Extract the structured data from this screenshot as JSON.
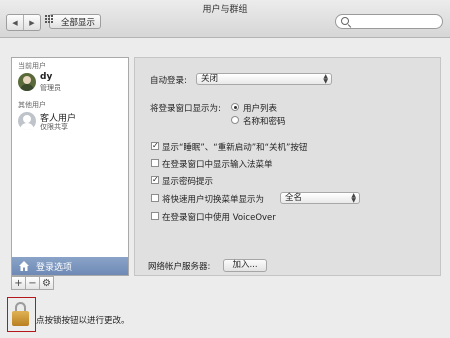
{
  "window": {
    "title": "用户与群组"
  },
  "toolbar": {
    "back_icon": "back-icon",
    "forward_icon": "forward-icon",
    "show_all_label": "全部显示",
    "search_placeholder": ""
  },
  "sidebar": {
    "current_users_label": "当前用户",
    "current_user": {
      "name": "dy",
      "role": "管理员"
    },
    "other_users_label": "其他用户",
    "guest_user": {
      "name": "客人用户",
      "role": "仅限共享"
    },
    "login_options_label": "登录选项",
    "add_label": "+",
    "remove_label": "−",
    "action_label": "⚙"
  },
  "options": {
    "auto_login_label": "自动登录:",
    "auto_login_value": "关闭",
    "display_login_as_label": "将登录窗口显示为:",
    "radio_list_label": "用户列表",
    "radio_name_pw_label": "名称和密码",
    "show_buttons_label": "显示“睡眠”、“重新启动”和“关机”按钮",
    "show_input_menu_label": "在登录窗口中显示输入法菜单",
    "show_password_hints_label": "显示密码提示",
    "fast_switch_label": "将快速用户切换菜单显示为",
    "fast_switch_value": "全名",
    "voiceover_label": "在登录窗口中使用 VoiceOver",
    "network_server_label": "网络帐户服务器:",
    "join_button_label": "加入..."
  },
  "state": {
    "show_buttons_checked": true,
    "show_input_menu_checked": false,
    "show_password_hints_checked": true,
    "fast_switch_checked": false,
    "voiceover_checked": false,
    "radio_selected": "用户列表"
  },
  "footer": {
    "lock_text": "点按锁按钮以进行更改。"
  },
  "colors": {
    "selection": "#7b95bf",
    "lock_highlight": "#b5181b"
  }
}
